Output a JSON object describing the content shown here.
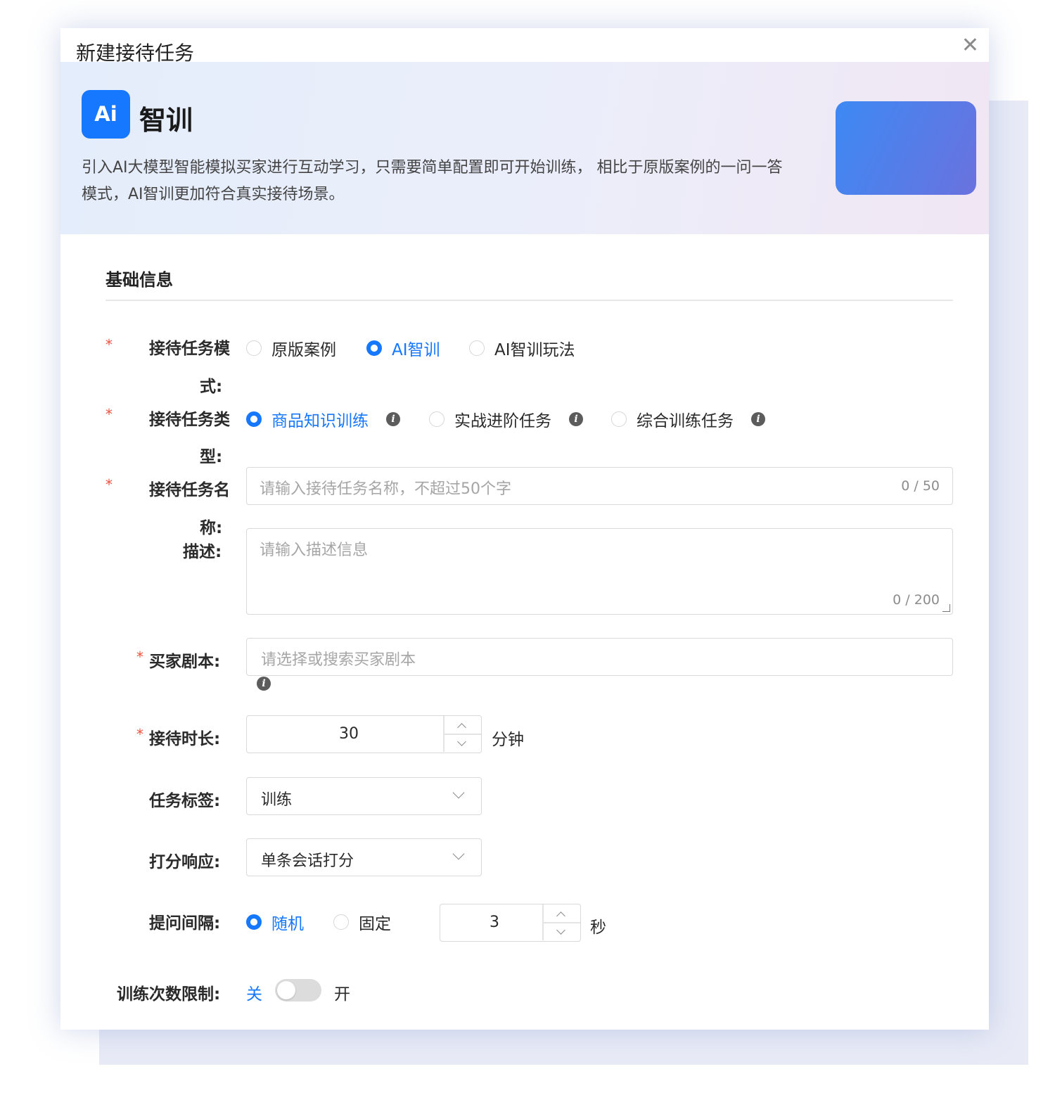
{
  "dialog": {
    "title": "新建接待任务",
    "close_icon": "close-icon"
  },
  "banner": {
    "logo_text": "Ai",
    "title": "智训",
    "desc_line1": "引入AI大模型智能模拟买家进行互动学习，只需要简单配置即可开始训练， 相比于原版案例的一问一答",
    "desc_line2": "模式，AI智训更加符合真实接待场景。"
  },
  "section": {
    "title": "基础信息"
  },
  "form": {
    "mode": {
      "label_line1": "接待任务模",
      "label_line2": "式:",
      "required_mark": "*",
      "options": [
        {
          "label": "原版案例",
          "checked": false
        },
        {
          "label": "AI智训",
          "checked": true
        },
        {
          "label": "AI智训玩法",
          "checked": false
        }
      ]
    },
    "type": {
      "label_line1": "接待任务类",
      "label_line2": "型:",
      "required_mark": "*",
      "info_glyph": "i",
      "options": [
        {
          "label": "商品知识训练",
          "checked": true
        },
        {
          "label": "实战进阶任务",
          "checked": false
        },
        {
          "label": "综合训练任务",
          "checked": false
        }
      ]
    },
    "name": {
      "label_line1": "接待任务名",
      "label_line2": "称:",
      "required_mark": "*",
      "placeholder": "请输入接待任务名称，不超过50个字",
      "counter": "0 / 50"
    },
    "description": {
      "label": "描述:",
      "placeholder": "请输入描述信息",
      "counter": "0 / 200"
    },
    "script": {
      "label": "买家剧本:",
      "required_mark": "*",
      "placeholder": "请选择或搜索买家剧本",
      "info_glyph": "i"
    },
    "duration": {
      "label": "接待时长:",
      "required_mark": "*",
      "value": "30",
      "unit": "分钟"
    },
    "tag": {
      "label": "任务标签:",
      "value": "训练"
    },
    "scoring": {
      "label": "打分响应:",
      "value": "单条会话打分"
    },
    "interval": {
      "label": "提问间隔:",
      "options": [
        {
          "label": "随机",
          "checked": true
        },
        {
          "label": "固定",
          "checked": false
        }
      ],
      "value": "3",
      "unit": "秒"
    },
    "limit": {
      "label": "训练次数限制:",
      "off_label": "关",
      "on_label": "开",
      "enabled": false
    }
  },
  "colors": {
    "accent": "#1677ff",
    "required": "#f0503c",
    "banner_start": "#e4edfb",
    "banner_end": "#f1e6f3"
  }
}
